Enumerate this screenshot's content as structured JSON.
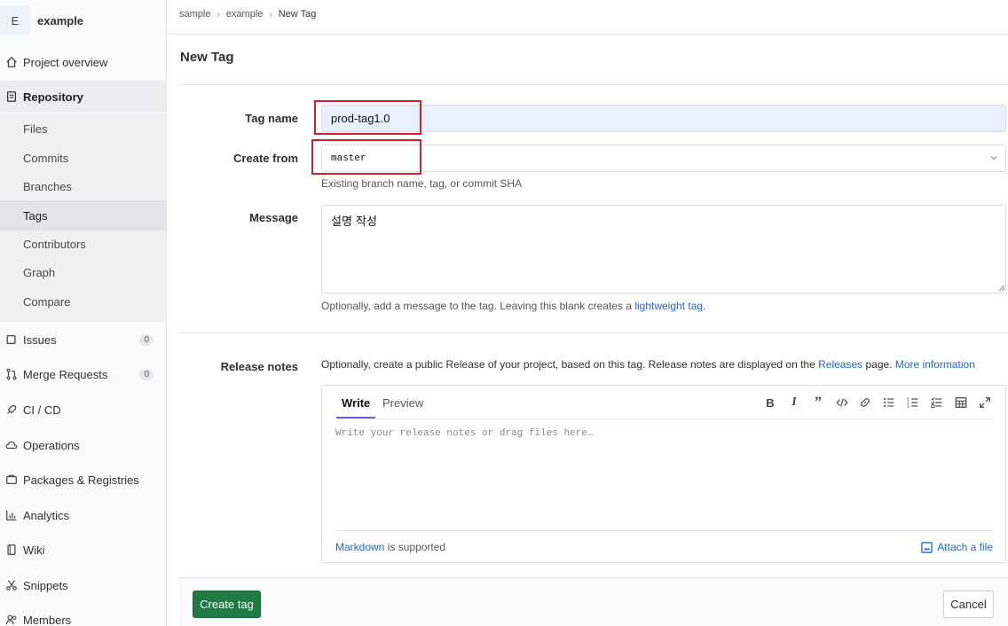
{
  "project": {
    "avatar_letter": "E",
    "name": "example"
  },
  "sidebar": {
    "overview": "Project overview",
    "repository": "Repository",
    "repo_items": [
      "Files",
      "Commits",
      "Branches",
      "Tags",
      "Contributors",
      "Graph",
      "Compare"
    ],
    "issues": {
      "label": "Issues",
      "count": "0"
    },
    "merge_requests": {
      "label": "Merge Requests",
      "count": "0"
    },
    "cicd": "CI / CD",
    "operations": "Operations",
    "packages": "Packages & Registries",
    "analytics": "Analytics",
    "wiki": "Wiki",
    "snippets": "Snippets",
    "members": "Members"
  },
  "breadcrumb": {
    "items": [
      "sample",
      "example"
    ],
    "current": "New Tag"
  },
  "page_title": "New Tag",
  "form": {
    "tag_name_label": "Tag name",
    "tag_name_value": "prod-tag1.0",
    "create_from_label": "Create from",
    "create_from_value": "master",
    "create_from_help": "Existing branch name, tag, or commit SHA",
    "message_label": "Message",
    "message_value": "설명 작성",
    "message_help_prefix": "Optionally, add a message to the tag. Leaving this blank creates a ",
    "message_help_link": "lightweight tag",
    "message_help_suffix": ".",
    "release_label": "Release notes",
    "release_help_prefix": "Optionally, create a public Release of your project, based on this tag. Release notes are displayed on the ",
    "release_help_link": "Releases",
    "release_help_mid": " page. ",
    "release_help_link2": "More information"
  },
  "editor": {
    "tab_write": "Write",
    "tab_preview": "Preview",
    "placeholder": "Write your release notes or drag files here…",
    "markdown_link": "Markdown",
    "markdown_suffix": " is supported",
    "attach_label": "Attach a file"
  },
  "buttons": {
    "create": "Create tag",
    "cancel": "Cancel"
  },
  "colors": {
    "primary": "#1f7a44",
    "link": "#1f67c7",
    "highlight": "#d3202d",
    "autofill": "#e8f0fe"
  }
}
